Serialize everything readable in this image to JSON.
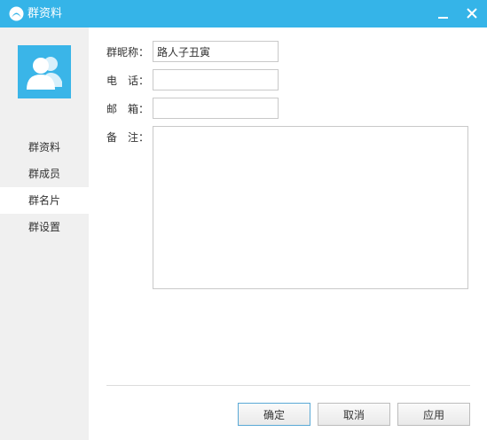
{
  "window": {
    "title": "群资料",
    "colors": {
      "titlebar": "#35b4e8",
      "sidebar": "#f0f0f0",
      "avatar": "#3ab5e8"
    }
  },
  "sidebar": {
    "avatar_icon": "group-avatar-icon",
    "items": [
      {
        "label": "群资料",
        "active": false
      },
      {
        "label": "群成员",
        "active": false
      },
      {
        "label": "群名片",
        "active": true
      },
      {
        "label": "群设置",
        "active": false
      }
    ]
  },
  "form": {
    "nickname_label": "群昵称：",
    "nickname_value": "路人子丑寅",
    "phone_label": "电　话：",
    "phone_value": "",
    "email_label": "邮　箱：",
    "email_value": "",
    "note_label": "备　注：",
    "note_value": ""
  },
  "buttons": {
    "ok": "确定",
    "cancel": "取消",
    "apply": "应用"
  }
}
